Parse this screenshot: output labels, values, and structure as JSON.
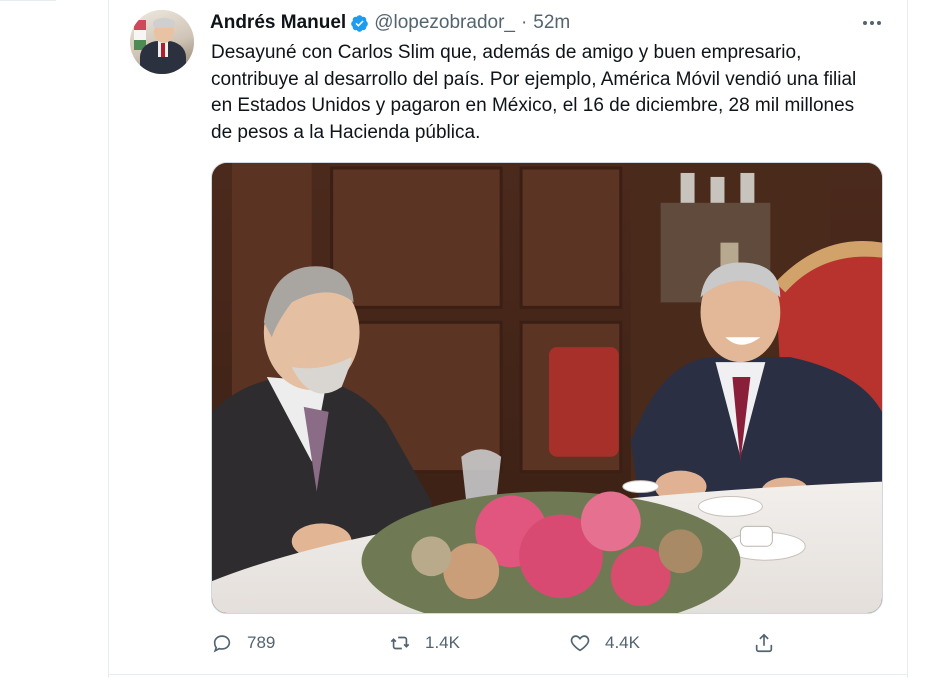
{
  "tweet": {
    "author_name": "Andrés Manuel",
    "handle": "@lopezobrador_",
    "separator": "·",
    "time": "52m",
    "text": "Desayuné con Carlos Slim que, además de amigo y buen empresario, contribuye al desarrollo del país. Por ejemplo, América Móvil vendió una filial en Estados Unidos y pagaron en México, el 16 de diciembre, 28 mil millones de pesos a la Hacienda pública.",
    "verified_icon": "verified-badge-icon",
    "verified_color": "#1d9bf0",
    "more_icon": "more-horizontal-icon"
  },
  "actions": {
    "reply_count": "789",
    "retweet_count": "1.4K",
    "like_count": "4.4K",
    "reply_icon": "reply-icon",
    "retweet_icon": "retweet-icon",
    "like_icon": "heart-icon",
    "share_icon": "share-icon"
  },
  "colors": {
    "text": "#0f1419",
    "secondary": "#536471",
    "border": "#e6ecf0"
  }
}
